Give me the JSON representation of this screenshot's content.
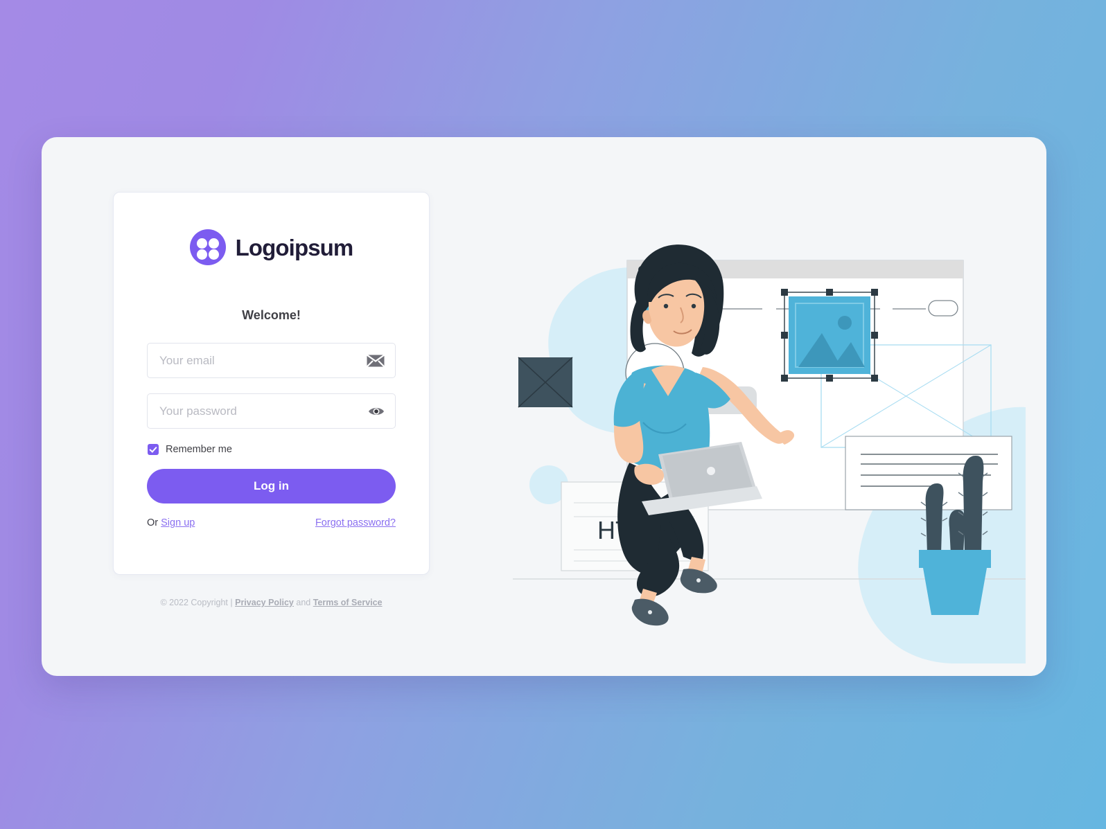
{
  "brand": {
    "name": "Logoipsum",
    "accent": "#7c5cf0",
    "logo_icon": "four-dot-clover-logo-icon"
  },
  "card": {
    "heading": "Welcome!",
    "email": {
      "placeholder": "Your email",
      "value": "",
      "icon": "envelope-icon"
    },
    "password": {
      "placeholder": "Your password",
      "value": "",
      "icon": "eye-icon"
    },
    "remember": {
      "label": "Remember me",
      "checked": true
    },
    "submit_label": "Log in",
    "or_label": "Or",
    "signup_label": "Sign up",
    "forgot_label": "Forgot password?"
  },
  "footer": {
    "copyright": "© 2022 Copyright |",
    "privacy_label": "Privacy Policy",
    "and_label": "and",
    "terms_label": "Terms of Service"
  },
  "illustration": {
    "name": "web-design-illustration",
    "code_bubble": "</>",
    "html_card_label": "HTML",
    "colors": {
      "blob": "#d6eef8",
      "teal": "#4fb3d9",
      "dark": "#38454f",
      "skin": "#f7c6a3",
      "hair": "#1f2b33",
      "laptop": "#c8ccd0"
    }
  },
  "background": {
    "gradient_from": "#a48ae6",
    "gradient_to": "#66b6e1",
    "panel_color": "#f4f6f8"
  }
}
